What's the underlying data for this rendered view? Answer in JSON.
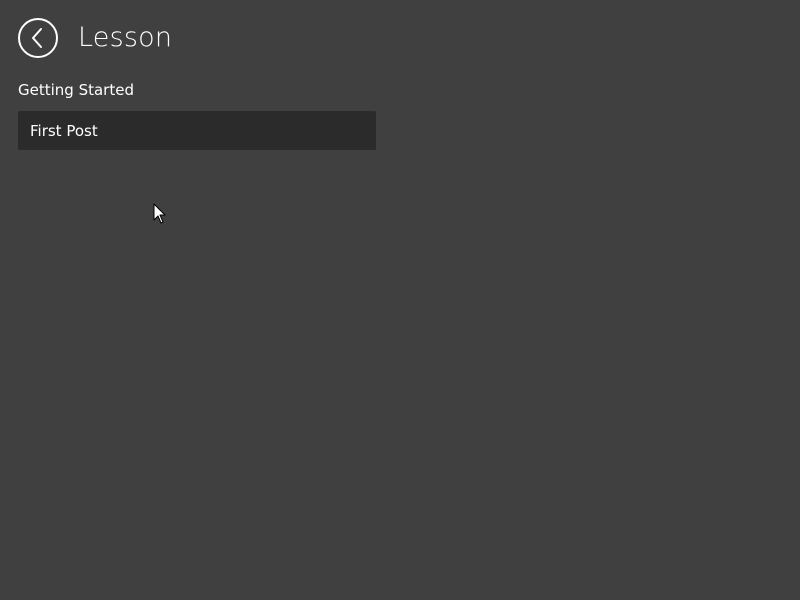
{
  "header": {
    "back_icon": "back-arrow-icon",
    "title": "Lesson"
  },
  "section": {
    "label": "Getting Started"
  },
  "lessons": [
    {
      "label": "First Post"
    }
  ],
  "colors": {
    "background": "#404040",
    "item_background": "#2b2b2b",
    "text": "#ffffff"
  }
}
